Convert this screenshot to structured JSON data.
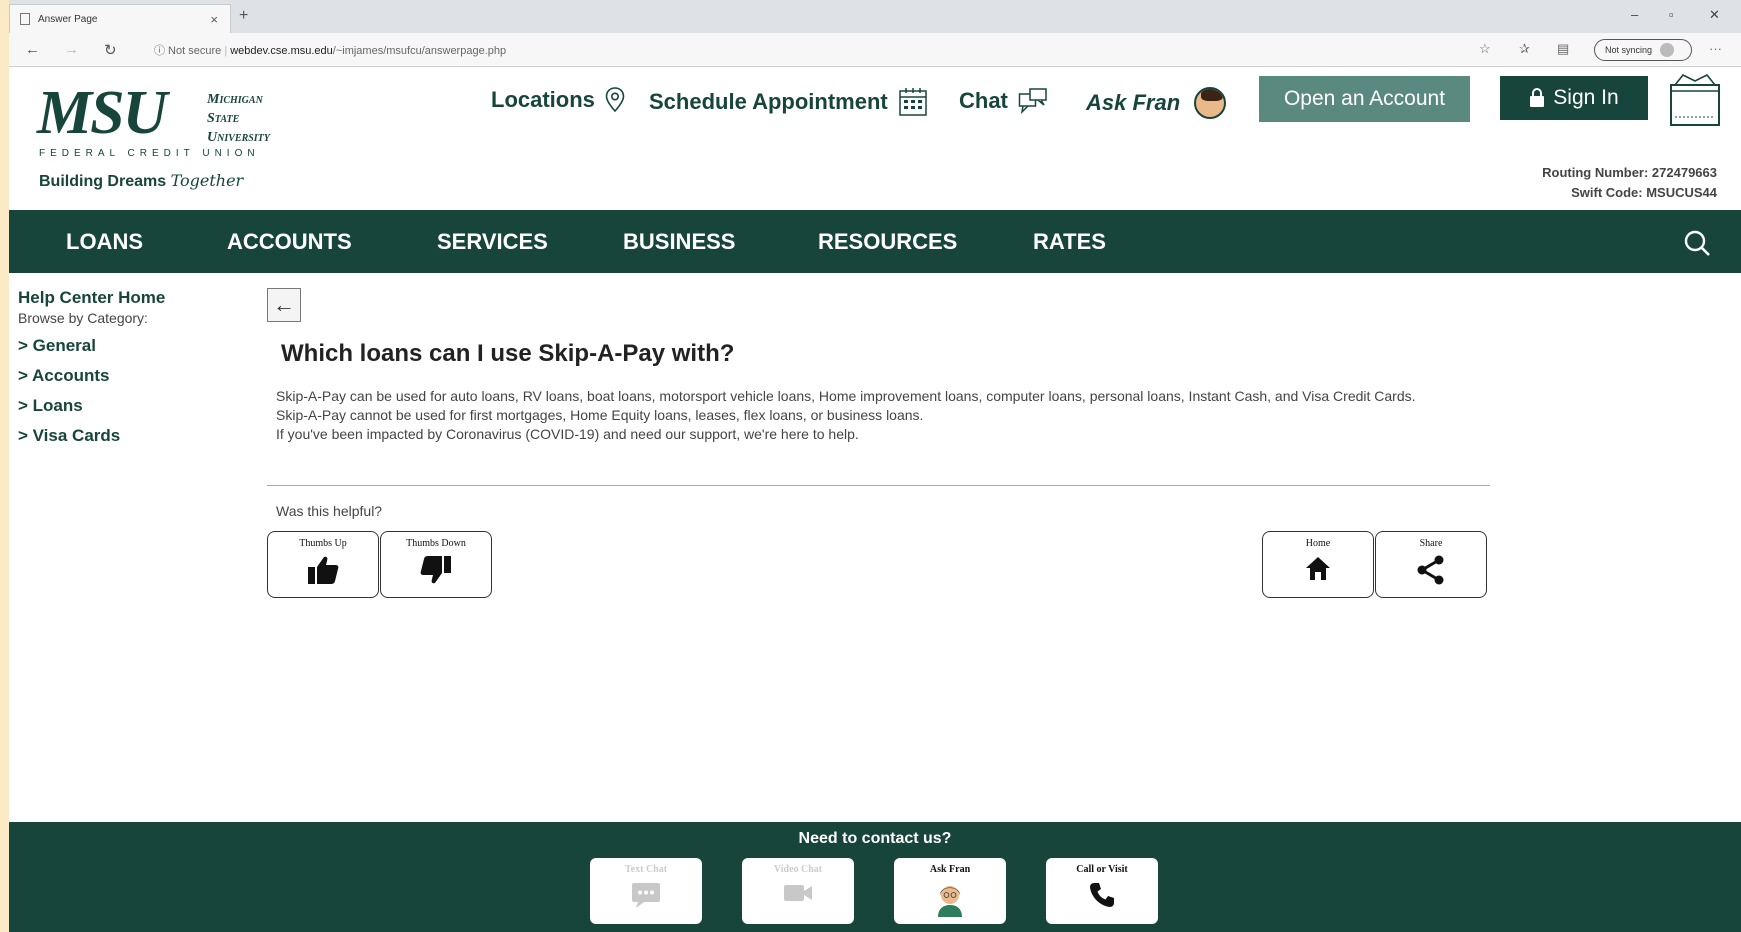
{
  "browser": {
    "tab_title": "Answer Page",
    "tab_close": "×",
    "new_tab": "+",
    "nav": {
      "back": "←",
      "forward": "→",
      "refresh": "↻"
    },
    "security": "ⓘ Not secure",
    "url_host": "webdev.cse.msu.edu",
    "url_path": "/~imjames/msufcu/answerpage.php",
    "sync_label": "Not syncing",
    "more": "···",
    "win_min": "–",
    "win_max": "▫",
    "win_close": "✕"
  },
  "header": {
    "logo_msu": "MSU",
    "logo_line1": "Michigan",
    "logo_line2": "State",
    "logo_line3": "University",
    "logo_fcu": "FEDERAL CREDIT UNION",
    "tagline_a": "Building Dreams ",
    "tagline_b": "Together",
    "locations": "Locations",
    "schedule": "Schedule Appointment",
    "chat": "Chat",
    "ask_fran": "Ask Fran",
    "open_account": "Open an Account",
    "sign_in": "Sign In",
    "routing": "Routing Number: 272479663",
    "swift": "Swift Code: MSUCUS44"
  },
  "nav": [
    "LOANS",
    "ACCOUNTS",
    "SERVICES",
    "BUSINESS",
    "RESOURCES",
    "RATES"
  ],
  "sidebar": {
    "home": "Help Center Home",
    "browse": "Browse by Category:",
    "categories": [
      "> General",
      "> Accounts",
      "> Loans",
      "> Visa Cards"
    ]
  },
  "main": {
    "back": "←",
    "question": "Which loans can I use Skip-A-Pay with?",
    "answer_line1": "Skip-A-Pay can be used for auto loans, RV loans, boat loans, motorsport vehicle loans, Home improvement loans, computer loans, personal loans, Instant Cash, and Visa Credit Cards.",
    "answer_line2": "Skip-A-Pay cannot be used for first mortgages, Home Equity loans, leases, flex loans, or business loans.",
    "answer_line3": "If you've been impacted by Coronavirus (COVID-19) and need our support, we're here to help.",
    "helpful": "Was this helpful?",
    "thumbs_up": "Thumbs Up",
    "thumbs_down": "Thumbs Down",
    "home": "Home",
    "share": "Share"
  },
  "footer": {
    "title": "Need to contact us?",
    "text_chat": "Text Chat",
    "video_chat": "Video Chat",
    "ask_fran": "Ask Fran",
    "call_visit": "Call or Visit"
  }
}
